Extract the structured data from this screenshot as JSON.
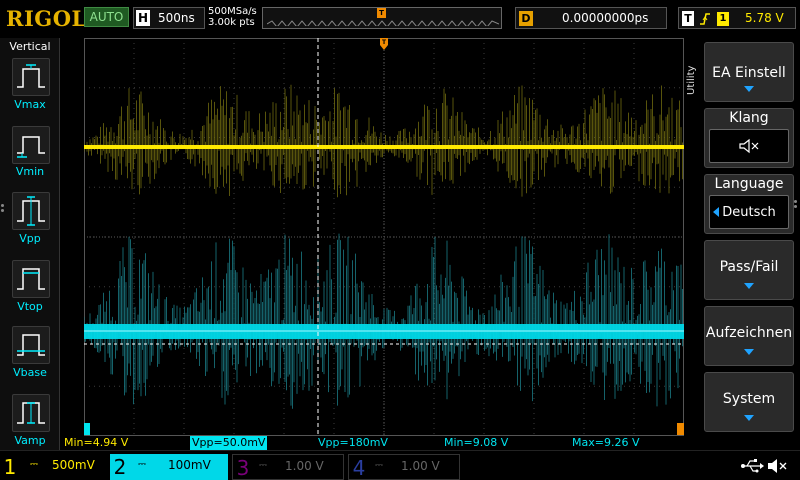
{
  "header": {
    "brand": "RIGOL",
    "run_mode": "AUTO",
    "timebase_letter": "H",
    "timebase_value": "500ns",
    "sample_rate": "500MSa/s",
    "memory_depth": "3.00k pts",
    "delay_letter": "D",
    "delay_value": "0.00000000ps",
    "trigger_letter": "T",
    "trigger_source": "1",
    "trigger_level": "5.78 V"
  },
  "left_panel": {
    "title": "Vertical",
    "items": [
      {
        "label": "Vmax",
        "icon": "vmax-icon"
      },
      {
        "label": "Vmin",
        "icon": "vmin-icon"
      },
      {
        "label": "Vpp",
        "icon": "vpp-icon"
      },
      {
        "label": "Vtop",
        "icon": "vtop-icon"
      },
      {
        "label": "Vbase",
        "icon": "vbase-icon"
      },
      {
        "label": "Vamp",
        "icon": "vamp-icon"
      }
    ]
  },
  "right_panel": {
    "title": "Utility",
    "buttons": [
      {
        "label": "EA Einstell",
        "arrow": "down"
      },
      {
        "label": "Klang",
        "sub_icon": "speaker-mute-icon"
      },
      {
        "label": "Language",
        "sub_value": "Deutsch"
      },
      {
        "label": "Pass/Fail",
        "arrow": "down"
      },
      {
        "label": "Aufzeichnen",
        "arrow": "down"
      },
      {
        "label": "System",
        "arrow": "down"
      }
    ]
  },
  "measurements": {
    "ch1_min": "Min=4.94 V",
    "ch1_vpp": "Vpp=50.0mV",
    "ch2_vpp": "Vpp=180mV",
    "ch2_min": "Min=9.08 V",
    "ch2_max": "Max=9.26 V"
  },
  "channels": [
    {
      "num": "1",
      "scale": "500mV",
      "color": "#ffea00",
      "active": true
    },
    {
      "num": "2",
      "scale": "100mV",
      "color": "#00e5f0",
      "active": true,
      "selected": true
    },
    {
      "num": "3",
      "scale": "1.00 V",
      "color": "#c000c0",
      "active": false
    },
    {
      "num": "4",
      "scale": "1.00 V",
      "color": "#3050ff",
      "active": false
    }
  ],
  "status_icons": [
    "usb-icon",
    "speaker-mute-icon"
  ],
  "colors": {
    "ch1": "#ffea00",
    "ch2": "#00e5f0",
    "trigger_marker": "#f08a00",
    "menu_arrow": "#1fa3ff"
  }
}
